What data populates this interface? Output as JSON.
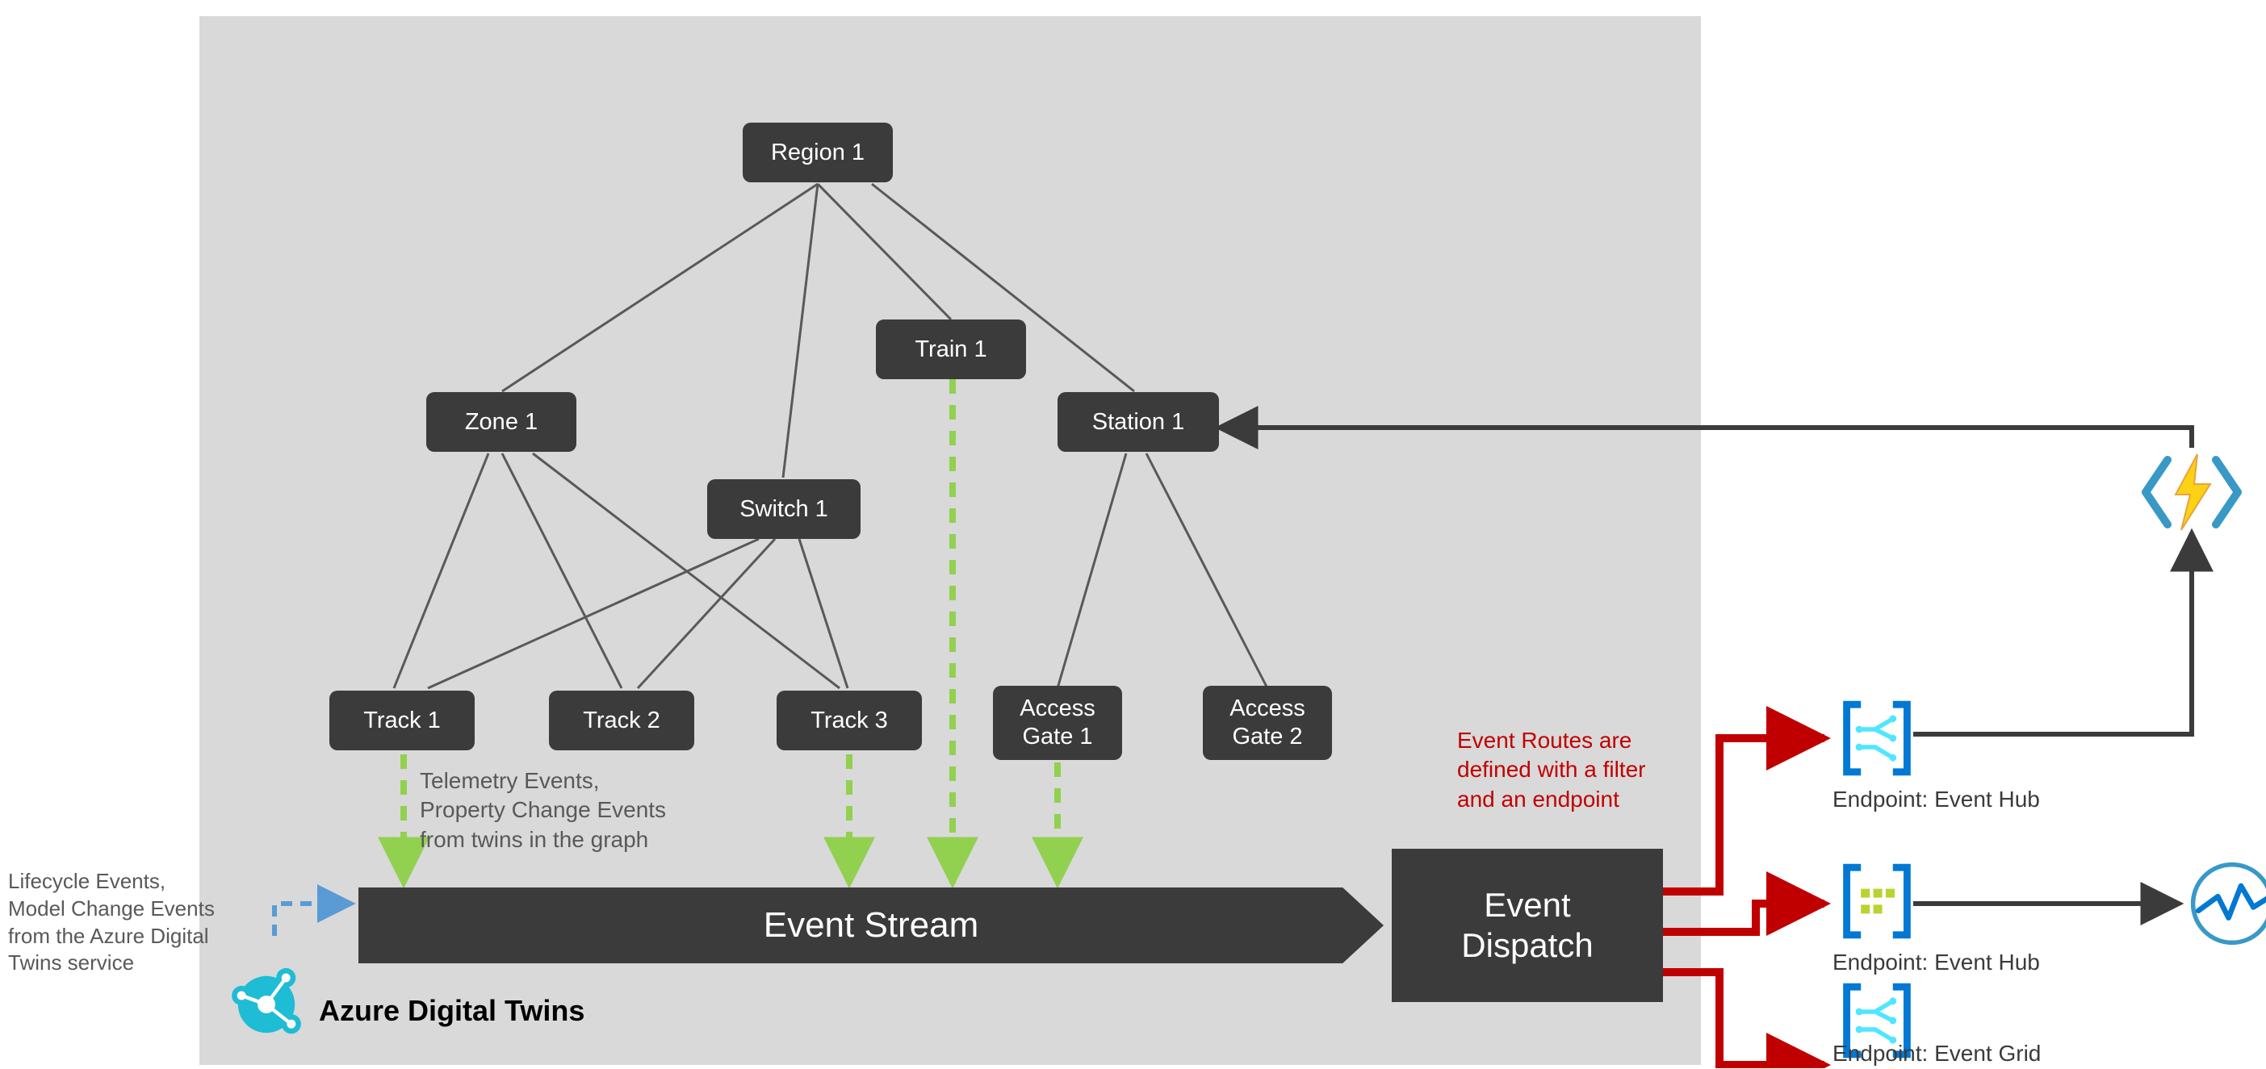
{
  "nodes": {
    "region1": "Region 1",
    "zone1": "Zone 1",
    "train1": "Train 1",
    "station1": "Station 1",
    "switch1": "Switch 1",
    "track1": "Track 1",
    "track2": "Track 2",
    "track3": "Track 3",
    "accessGate1": "Access\nGate 1",
    "accessGate2": "Access\nGate 2"
  },
  "bars": {
    "eventStream": "Event Stream",
    "eventDispatch": "Event\nDispatch"
  },
  "labels": {
    "telemetry": "Telemetry Events,\nProperty Change Events\nfrom twins in the graph",
    "lifecycle": "Lifecycle Events,\nModel Change Events\nfrom the Azure Digital\nTwins service",
    "eventRoutes": "Event Routes are\ndefined with a filter\nand an endpoint",
    "adt": "Azure Digital Twins"
  },
  "endpoints": {
    "hub1": "Endpoint: Event Hub",
    "hub2": "Endpoint: Event Hub",
    "grid": "Endpoint: Event Grid"
  },
  "colors": {
    "nodeBg": "#3b3b3b",
    "panel": "#d9d9d9",
    "redArrow": "#c00000",
    "greenDash": "#92d050",
    "blueDash": "#5b9bd5",
    "azureBlue": "#0078d4",
    "adtTeal": "#1ebcd5"
  }
}
